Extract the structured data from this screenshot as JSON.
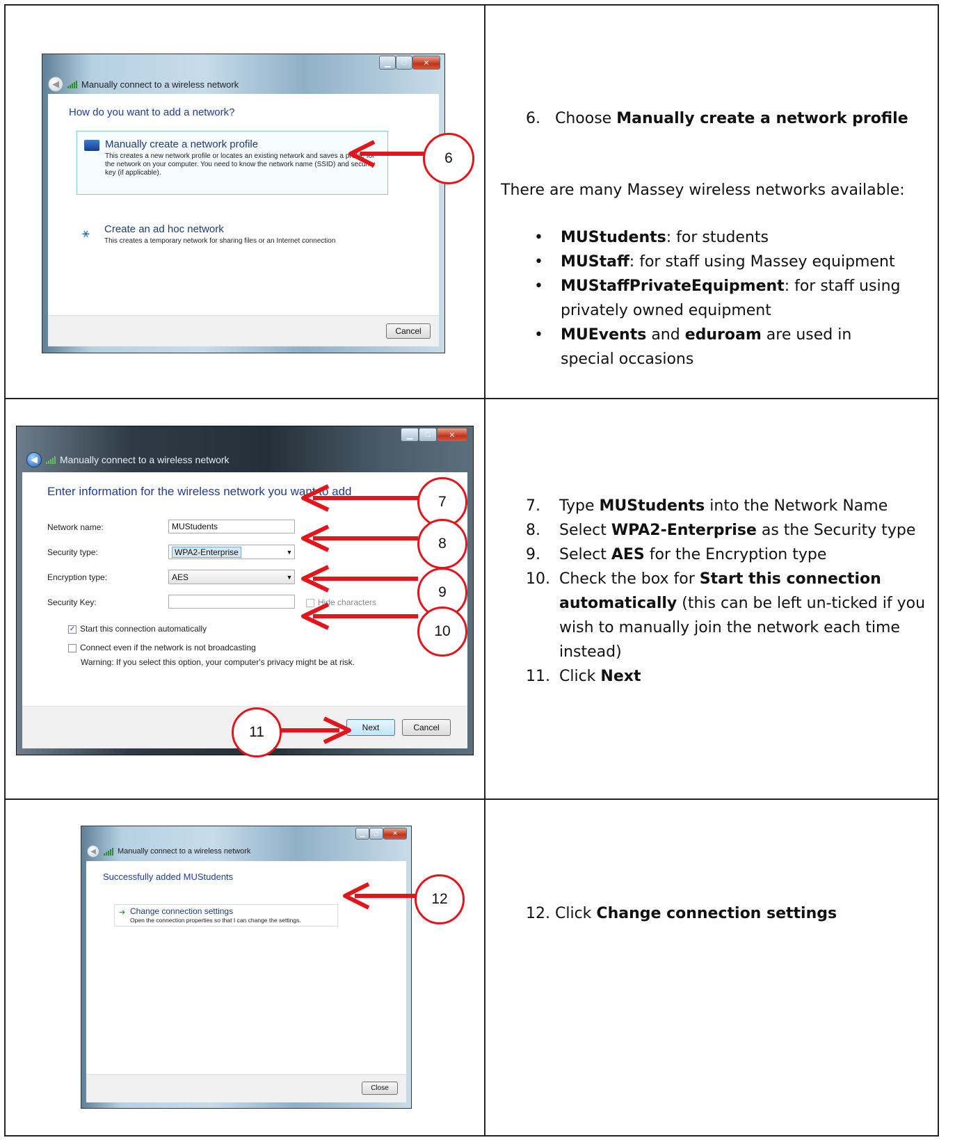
{
  "rows": [
    {
      "dialog": {
        "title": "Manually connect to a wireless network",
        "heading": "How do you want to add a network?",
        "option1": {
          "label": "Manually create a network profile",
          "desc": "This creates a new network profile or locates an existing network and saves a profile for the network on your computer. You need to know the network name (SSID) and security key (if applicable)."
        },
        "option2": {
          "label": "Create an ad hoc network",
          "desc": "This creates a temporary network for sharing files or an Internet connection"
        },
        "cancel": "Cancel"
      },
      "callouts": [
        "6"
      ],
      "text": {
        "step": "6.",
        "step_prefix": "Choose ",
        "step_bold": "Manually create a network profile",
        "intro": "There are many Massey wireless networks available:",
        "bullets": [
          {
            "bold": "MUStudents",
            "rest": ": for students"
          },
          {
            "bold": "MUStaff",
            "rest": ": for staff using Massey equipment"
          },
          {
            "bold": "MUStaffPrivateEquipment",
            "rest": ": for staff using privately owned equipment"
          },
          {
            "bold": "MUEvents",
            "mid": " and ",
            "bold2": "eduroam",
            "rest": " are used in special occasions"
          }
        ]
      }
    },
    {
      "dialog": {
        "title": "Manually connect to a wireless network",
        "heading": "Enter information for the wireless network you want to add",
        "network_name_label": "Network name:",
        "network_name_value": "MUStudents",
        "security_type_label": "Security type:",
        "security_type_value": "WPA2-Enterprise",
        "encryption_type_label": "Encryption type:",
        "encryption_type_value": "AES",
        "security_key_label": "Security Key:",
        "hide_characters": "Hide characters",
        "start_auto": "Start this connection automatically",
        "connect_even": "Connect even if the network is not broadcasting",
        "warning": "Warning: If you select this option, your computer's privacy might be at risk.",
        "next": "Next",
        "cancel": "Cancel"
      },
      "callouts": [
        "7",
        "8",
        "9",
        "10",
        "11"
      ],
      "text": {
        "steps": [
          {
            "num": "7.",
            "pre": "Type ",
            "bold": "MUStudents",
            "post": " into the Network Name"
          },
          {
            "num": "8.",
            "pre": "Select ",
            "bold": "WPA2-Enterprise",
            "post": " as the Security type"
          },
          {
            "num": "9.",
            "pre": "Select ",
            "bold": "AES",
            "post": " for the Encryption type"
          },
          {
            "num": "10.",
            "pre": "Check the box for ",
            "bold": "Start this connection automatically",
            "post": " (this can be left un-ticked if you wish to manually join the network each time instead)"
          },
          {
            "num": "11.",
            "pre": "Click ",
            "bold": "Next",
            "post": ""
          }
        ]
      }
    },
    {
      "dialog": {
        "title": "Manually connect to a wireless network",
        "heading": "Successfully added MUStudents",
        "option_label": "Change connection settings",
        "option_desc": "Open the connection properties so that I can change the settings.",
        "close": "Close"
      },
      "callouts": [
        "12"
      ],
      "text": {
        "step": "12.",
        "step_prefix": "Click ",
        "step_bold": "Change connection settings"
      }
    }
  ],
  "colors": {
    "callout_red": "#e4141b",
    "dialog_heading_blue": "#1e3d8f"
  }
}
